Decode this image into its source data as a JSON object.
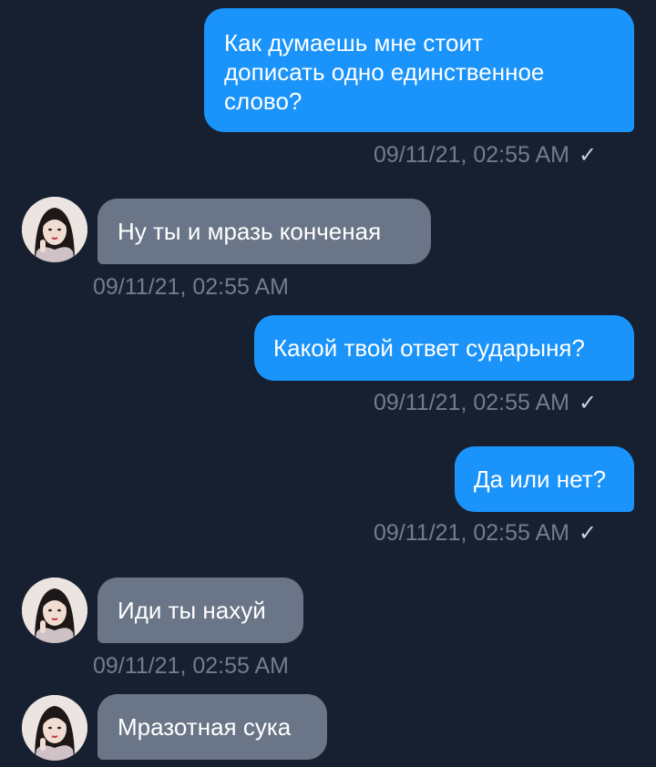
{
  "messages": [
    {
      "direction": "outgoing",
      "lines": [
        "Как думаешь мне стоит",
        "дописать одно единственное",
        "слово?"
      ],
      "time": "09/11/21, 02:55 AM",
      "read_mark": "✓"
    },
    {
      "direction": "incoming",
      "lines": [
        "Ну ты и мразь конченая"
      ],
      "time": "09/11/21, 02:55 AM"
    },
    {
      "direction": "outgoing",
      "lines": [
        "Какой твой ответ сударыня?"
      ],
      "time": "09/11/21, 02:55 AM",
      "read_mark": "✓"
    },
    {
      "direction": "outgoing",
      "lines": [
        "Да или нет?"
      ],
      "time": "09/11/21, 02:55 AM",
      "read_mark": "✓"
    },
    {
      "direction": "incoming",
      "lines": [
        "Иди ты нахуй"
      ],
      "time": "09/11/21, 02:55 AM"
    },
    {
      "direction": "incoming",
      "lines": [
        "Мразотная сука"
      ]
    }
  ],
  "colors": {
    "background": "#172031",
    "outgoing_bubble": "#1a93fa",
    "incoming_bubble": "#6a7588",
    "timestamp": "#717d8f"
  },
  "icons": {
    "read_mark": "check-icon",
    "avatar": "contact-avatar"
  }
}
